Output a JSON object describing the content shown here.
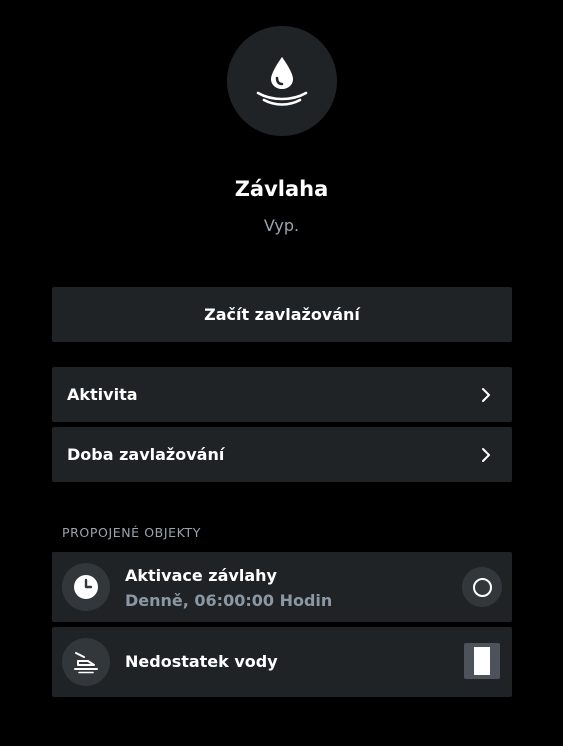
{
  "device": {
    "icon": "water-drop-icon",
    "name": "Závlaha",
    "status": "Vyp."
  },
  "actions": {
    "start_label": "Začít zavlažování"
  },
  "menu": [
    {
      "label": "Aktivita",
      "icon": "chevron-right-icon"
    },
    {
      "label": "Doba zavlažování",
      "icon": "chevron-right-icon"
    }
  ],
  "linked": {
    "section_label": "PROPOJENÉ OBJEKTY",
    "items": [
      {
        "icon": "clock-icon",
        "title": "Aktivace závlahy",
        "subtitle": "Denně, 06:00:00 Hodin",
        "control": "radio-circle"
      },
      {
        "icon": "water-shortage-icon",
        "title": "Nedostatek vody",
        "control": "switch-toggle"
      }
    ]
  },
  "colors": {
    "background": "#000000",
    "card": "#202326",
    "icon_bg": "#32373b",
    "muted_text": "#9aa4ad",
    "subtitle_text": "#8b98a3"
  }
}
